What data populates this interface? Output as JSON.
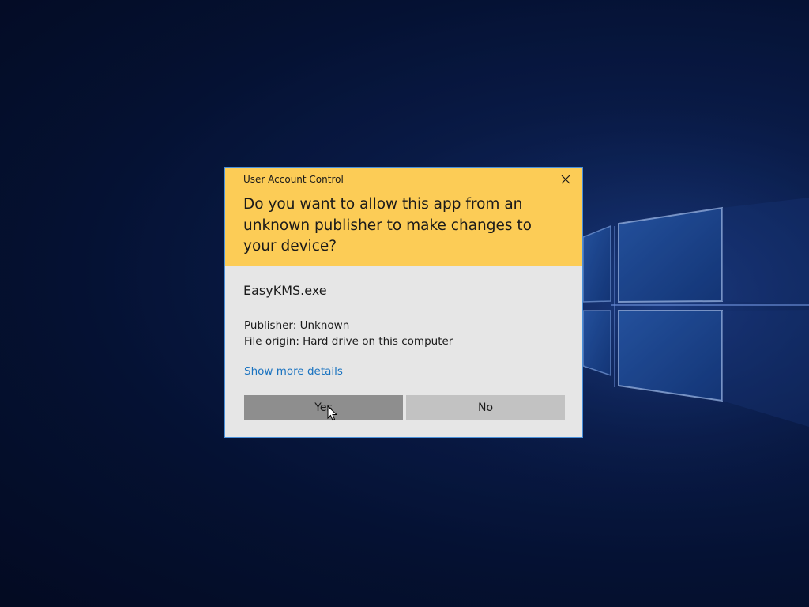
{
  "uac": {
    "title": "User Account Control",
    "question": "Do you want to allow this app from an unknown publisher to make changes to your device?",
    "app_name": "EasyKMS.exe",
    "publisher": "Publisher: Unknown",
    "file_origin": "File origin: Hard drive on this computer",
    "more_details": "Show more details",
    "yes_label": "Yes",
    "no_label": "No",
    "close_icon": "close-icon"
  },
  "colors": {
    "header": "#fccc56",
    "body": "#e6e6e6",
    "link": "#1a73c0",
    "yes_button": "#8e8e8e",
    "no_button": "#c2c2c2",
    "border": "#4a90d9"
  }
}
